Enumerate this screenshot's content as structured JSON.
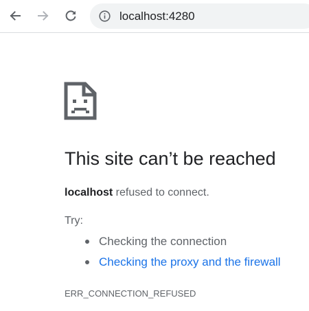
{
  "browser": {
    "address": "localhost:4280",
    "icons": {
      "back": "back-arrow-icon",
      "forward": "forward-arrow-icon",
      "reload": "reload-icon",
      "site_info": "info-icon"
    }
  },
  "error_page": {
    "icon": "sad-page-icon",
    "title": "This site can’t be reached",
    "host": "localhost",
    "summary_suffix": " refused to connect.",
    "try_label": "Try:",
    "suggestions": [
      {
        "label": "Checking the connection",
        "is_link": false
      },
      {
        "label": "Checking the proxy and the firewall",
        "is_link": true
      }
    ],
    "error_code": "ERR_CONNECTION_REFUSED"
  },
  "colors": {
    "link": "#1a73e8",
    "text_primary": "#202124",
    "text_secondary": "#5f6368",
    "omnibox_bg": "#f1f3f4"
  }
}
